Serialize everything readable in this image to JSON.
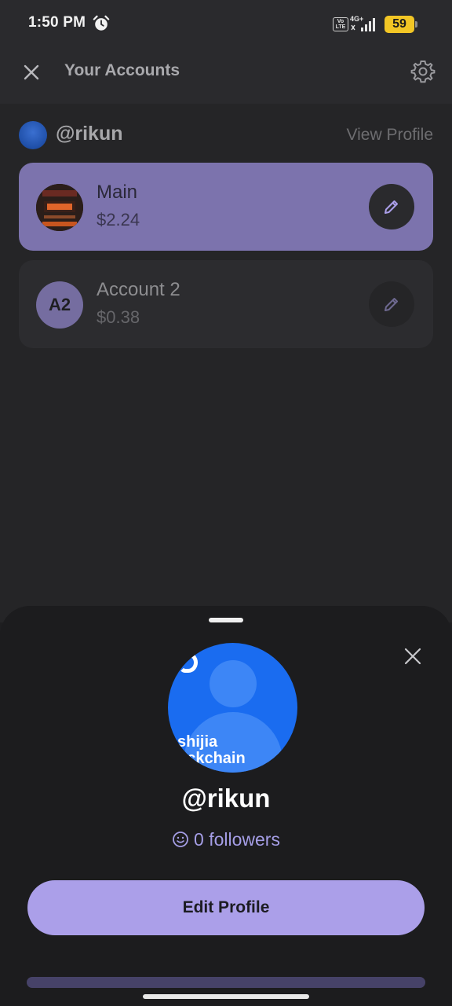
{
  "status_bar": {
    "time": "1:50 PM",
    "network": "4G+",
    "volte": "Vo LTE",
    "battery": "59",
    "alarm_icon": "alarm-clock-icon",
    "battery_color": "#f2c625"
  },
  "header": {
    "title": "Your Accounts",
    "close_icon": "close-icon",
    "settings_icon": "gear-icon"
  },
  "profile": {
    "handle": "@rikun",
    "view_profile_label": "View Profile"
  },
  "accounts": [
    {
      "name": "Main",
      "balance": "$2.24",
      "avatar": "image",
      "selected": true
    },
    {
      "name": "Account 2",
      "balance": "$0.38",
      "avatar_initials": "A2",
      "selected": false
    }
  ],
  "sheet": {
    "avatar_text": "shijia\nockchain",
    "handle": "@rikun",
    "followers_text": "0 followers",
    "edit_profile_label": "Edit Profile"
  },
  "colors": {
    "accent": "#ab9fe9",
    "selected_card": "#7c73ad",
    "background": "#1e1e20",
    "avatar_blue": "#1a6cf0"
  }
}
